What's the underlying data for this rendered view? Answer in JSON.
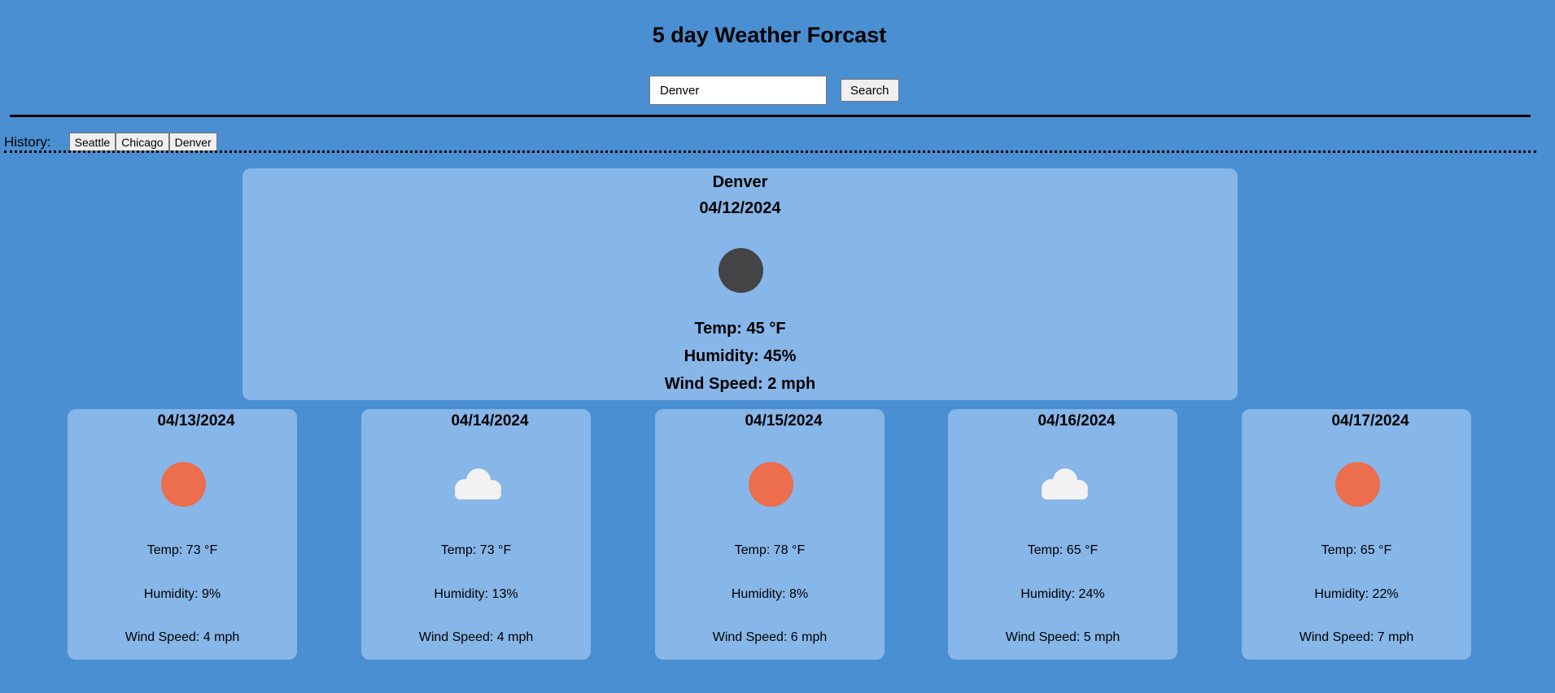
{
  "page": {
    "title": "5 day Weather Forcast"
  },
  "search": {
    "value": "Denver",
    "button_label": "Search"
  },
  "history": {
    "label": "History:",
    "items": [
      "Seattle",
      "Chicago",
      "Denver"
    ]
  },
  "current": {
    "city": "Denver",
    "date": "04/12/2024",
    "icon": "moon-icon",
    "temp": "Temp: 45 °F",
    "humidity": "Humidity: 45%",
    "wind": "Wind Speed: 2 mph"
  },
  "forecast": [
    {
      "date": "04/13/2024",
      "icon": "sun-icon",
      "temp": "Temp: 73 °F",
      "humidity": "Humidity: 9%",
      "wind": "Wind Speed: 4 mph"
    },
    {
      "date": "04/14/2024",
      "icon": "cloud-icon",
      "temp": "Temp: 73 °F",
      "humidity": "Humidity: 13%",
      "wind": "Wind Speed: 4 mph"
    },
    {
      "date": "04/15/2024",
      "icon": "sun-icon",
      "temp": "Temp: 78 °F",
      "humidity": "Humidity: 8%",
      "wind": "Wind Speed: 6 mph"
    },
    {
      "date": "04/16/2024",
      "icon": "cloud-icon",
      "temp": "Temp: 65 °F",
      "humidity": "Humidity: 24%",
      "wind": "Wind Speed: 5 mph"
    },
    {
      "date": "04/17/2024",
      "icon": "sun-icon",
      "temp": "Temp: 65 °F",
      "humidity": "Humidity: 22%",
      "wind": "Wind Speed: 7 mph"
    }
  ],
  "colors": {
    "background": "#4a8fd1",
    "card": "#87b6e8",
    "sun": "#ec6e4c",
    "moon": "#444446",
    "cloud": "#f2f2f2"
  }
}
